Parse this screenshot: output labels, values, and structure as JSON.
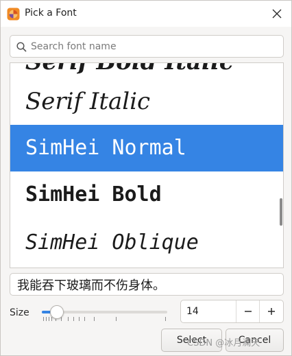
{
  "window": {
    "title": "Pick a Font"
  },
  "search": {
    "placeholder": "Search font name",
    "value": ""
  },
  "font_list": {
    "items": [
      {
        "label": "Serif Bold Italic",
        "selected": false
      },
      {
        "label": "Serif Italic",
        "selected": false
      },
      {
        "label": "SimHei Normal",
        "selected": true
      },
      {
        "label": "SimHei Bold",
        "selected": false
      },
      {
        "label": "SimHei Oblique",
        "selected": false
      }
    ],
    "selection_color": "#3584e4"
  },
  "preview": {
    "text": "我能吞下玻璃而不伤身体。"
  },
  "size": {
    "label": "Size",
    "value": "14",
    "slider_fraction": 0.12
  },
  "buttons": {
    "select": "Select",
    "cancel": "Cancel"
  },
  "icons": {
    "app": "font-app-icon",
    "close": "close-icon",
    "search": "search-icon",
    "minus": "minus-icon",
    "plus": "plus-icon"
  },
  "watermark": "CSDN @冰月澜天"
}
